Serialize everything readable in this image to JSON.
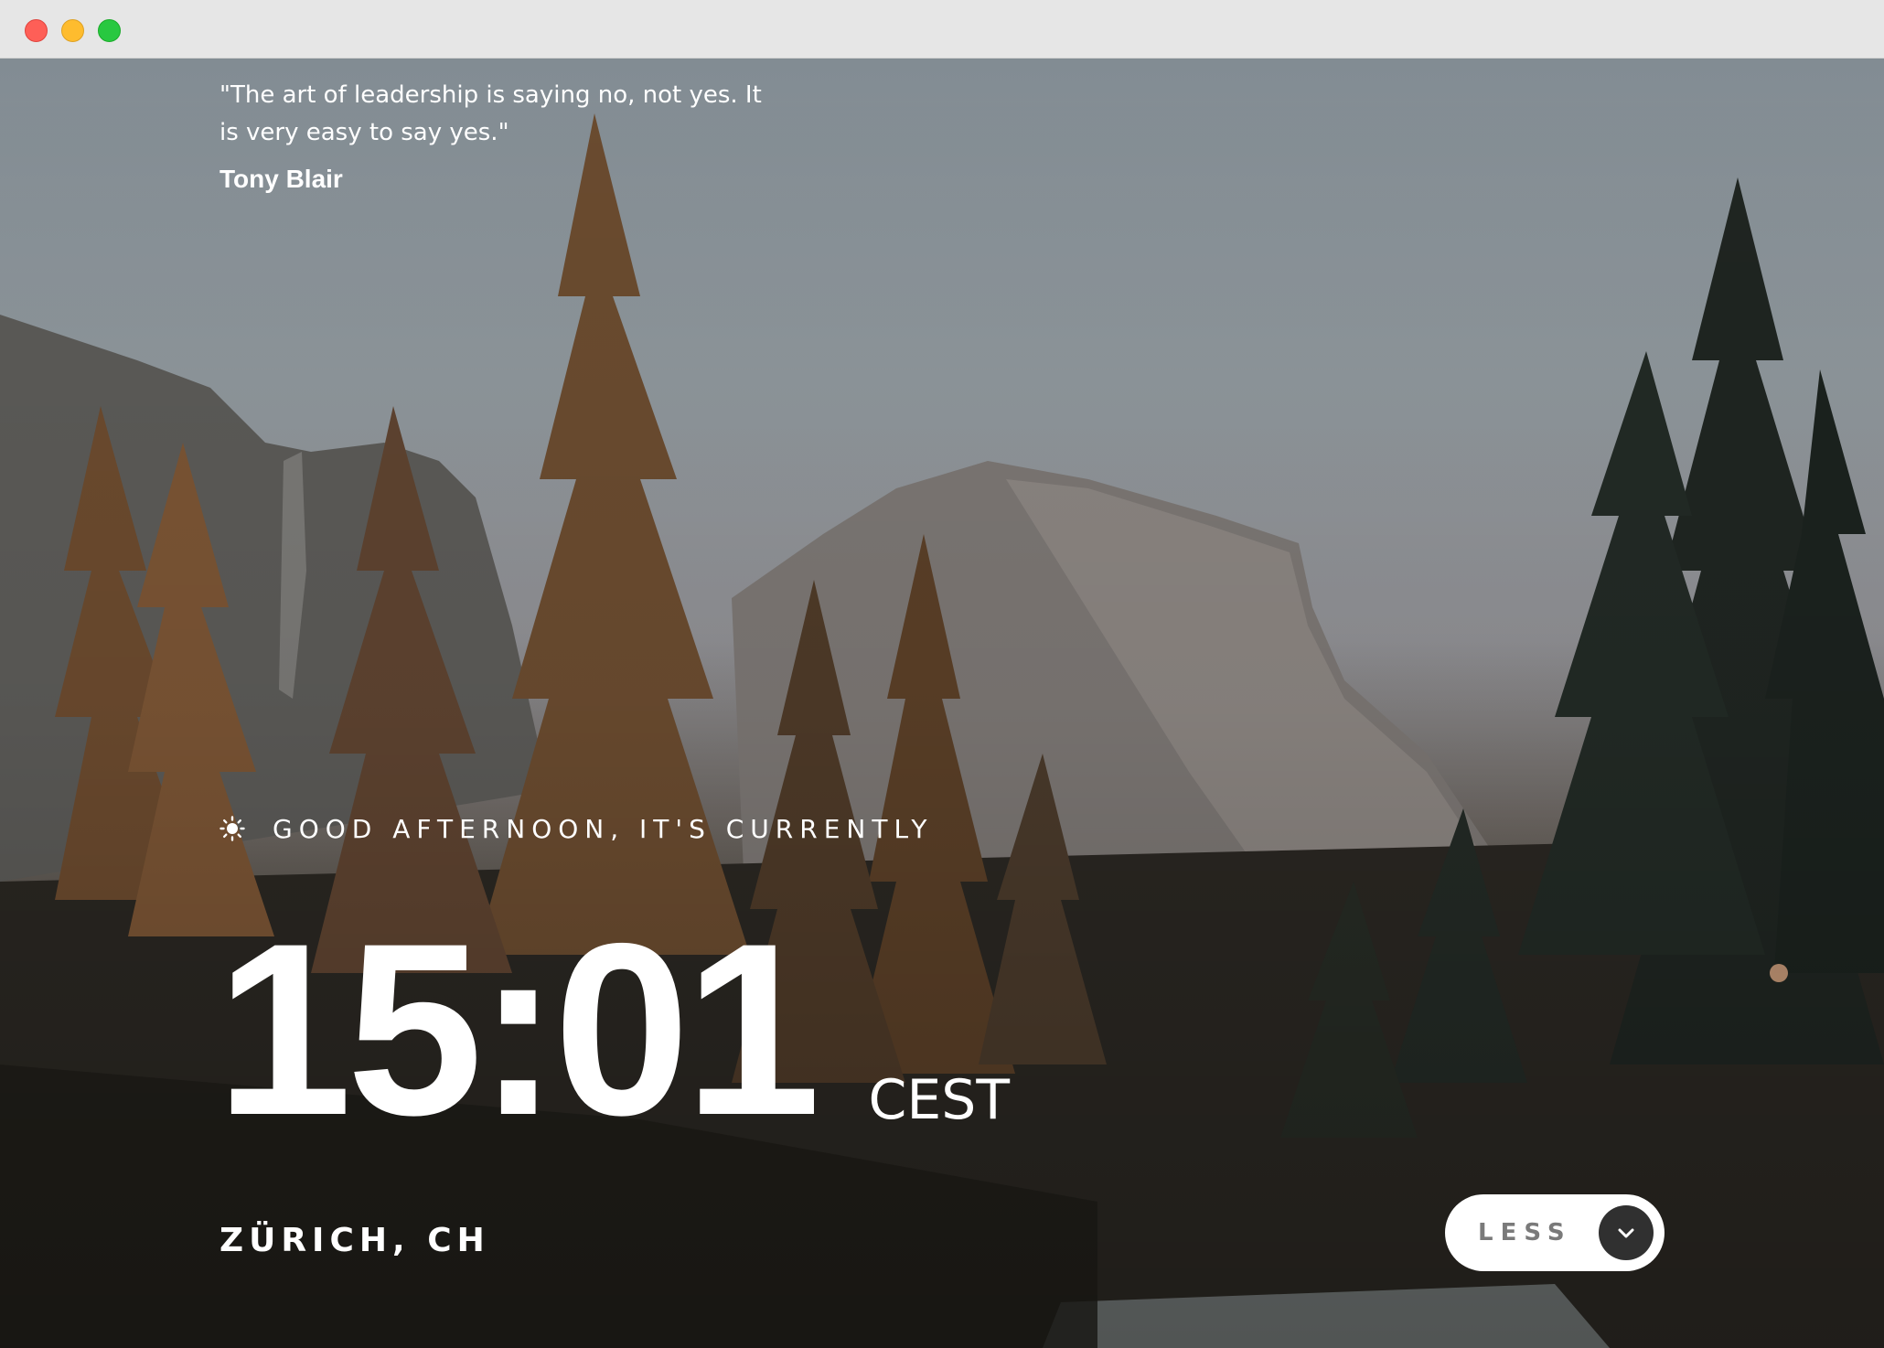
{
  "quote": {
    "text": "\"The art of leadership is saying no, not yes. It is very easy to say yes.\"",
    "author": "Tony Blair"
  },
  "greeting": {
    "icon": "sun-icon",
    "text": "GOOD AFTERNOON, IT'S CURRENTLY"
  },
  "clock": {
    "time": "15:01",
    "timezone": "CEST"
  },
  "location": {
    "text": "ZÜRICH, CH"
  },
  "toggle": {
    "label": "LESS",
    "icon": "chevron-down-icon"
  },
  "colors": {
    "titlebar": "#e6e6e6",
    "close": "#fe5f57",
    "minimize": "#febc2e",
    "zoom": "#28c840",
    "text": "#ffffff",
    "toggle_bg": "#ffffff",
    "toggle_knob": "#303030"
  }
}
